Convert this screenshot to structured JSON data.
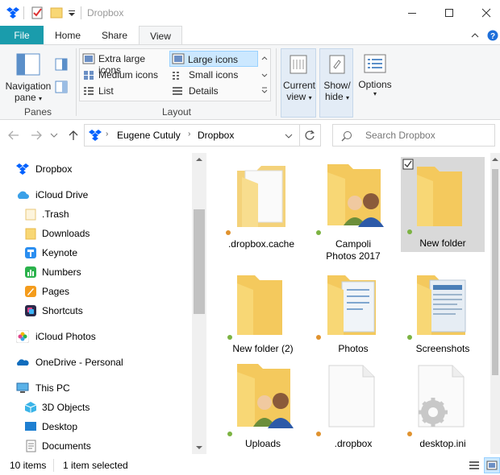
{
  "window": {
    "title": "Dropbox"
  },
  "ribbon_tabs": [
    "File",
    "Home",
    "Share",
    "View"
  ],
  "ribbon": {
    "panes": {
      "nav_pane_line1": "Navigation",
      "nav_pane_line2": "pane",
      "group": "Panes"
    },
    "layout": {
      "options": [
        "Extra large icons",
        "Large icons",
        "Medium icons",
        "Small icons",
        "List",
        "Details"
      ],
      "selected": "Large icons",
      "group": "Layout"
    },
    "current_view": {
      "line1": "Current",
      "line2": "view"
    },
    "show_hide": {
      "line1": "Show/",
      "line2": "hide"
    },
    "options": "Options"
  },
  "address": {
    "breadcrumb": [
      "Eugene Cutuly",
      "Dropbox"
    ],
    "search_placeholder": "Search Dropbox"
  },
  "nav": [
    {
      "label": "Dropbox",
      "icon": "dropbox-icon"
    },
    {
      "label": "iCloud Drive",
      "icon": "icloud-icon"
    },
    {
      "label": ".Trash",
      "icon": "folder-icon"
    },
    {
      "label": "Downloads",
      "icon": "folder-icon"
    },
    {
      "label": "Keynote",
      "icon": "keynote-icon"
    },
    {
      "label": "Numbers",
      "icon": "numbers-icon"
    },
    {
      "label": "Pages",
      "icon": "pages-icon"
    },
    {
      "label": "Shortcuts",
      "icon": "shortcuts-icon"
    },
    {
      "label": "iCloud Photos",
      "icon": "photos-icon"
    },
    {
      "label": "OneDrive - Personal",
      "icon": "onedrive-icon"
    },
    {
      "label": "This PC",
      "icon": "pc-icon"
    },
    {
      "label": "3D Objects",
      "icon": "3d-objects-icon"
    },
    {
      "label": "Desktop",
      "icon": "desktop-icon"
    },
    {
      "label": "Documents",
      "icon": "documents-icon"
    }
  ],
  "files": [
    {
      "name": ".dropbox.cache",
      "type": "folder-doc",
      "status": "orange"
    },
    {
      "name": "Campoli Photos 2017",
      "type": "folder-people",
      "status": "green"
    },
    {
      "name": "New folder",
      "type": "folder",
      "status": "green",
      "selected": true
    },
    {
      "name": "New folder (2)",
      "type": "folder",
      "status": "green"
    },
    {
      "name": "Photos",
      "type": "folder-docs",
      "status": "orange"
    },
    {
      "name": "Screenshots",
      "type": "folder-screens",
      "status": "green"
    },
    {
      "name": "Uploads",
      "type": "folder-people",
      "status": "green"
    },
    {
      "name": ".dropbox",
      "type": "file",
      "status": "orange"
    },
    {
      "name": "desktop.ini",
      "type": "settings-file",
      "status": "orange"
    }
  ],
  "status": {
    "count": "10 items",
    "selection": "1 item selected"
  },
  "colors": {
    "accent": "#1a9cac",
    "folder": "#f8d775",
    "folder_dark": "#e8b94a",
    "status_green": "#7cb342",
    "status_orange": "#e0922f",
    "selection": "#cce8ff"
  }
}
